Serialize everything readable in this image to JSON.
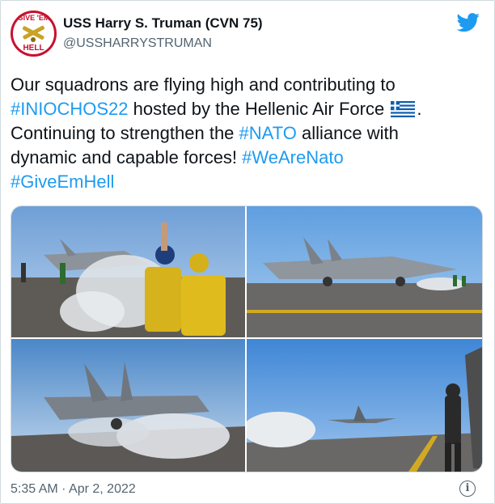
{
  "account": {
    "avatar_top_text": "GIVE 'EM",
    "avatar_bottom_text": "HELL",
    "display_name": "USS Harry S. Truman (CVN 75)",
    "handle": "@USSHARRYSTRUMAN"
  },
  "icons": {
    "platform": "twitter-bird-icon",
    "flag": "greece-flag-icon",
    "info": "info-icon"
  },
  "tweet": {
    "line1": "Our squadrons are flying high and contributing to",
    "tag1": "#INIOCHOS22",
    "mid1": " hosted by the Hellenic Air Force ",
    "end1": ".",
    "mid2": "Continuing to strengthen the ",
    "tag2": "#NATO",
    "mid3": " alliance with",
    "mid4": "dynamic and capable forces! ",
    "tag3": "#WeAreNato",
    "tag4": "#GiveEmHell"
  },
  "footer": {
    "timestamp": "5:35 AM · Apr 2, 2022",
    "info_glyph": "i"
  },
  "colors": {
    "link": "#1d9bf0",
    "secondary_text": "#536471",
    "twitter_blue": "#1d9bf0",
    "avatar_red": "#c8102e"
  }
}
